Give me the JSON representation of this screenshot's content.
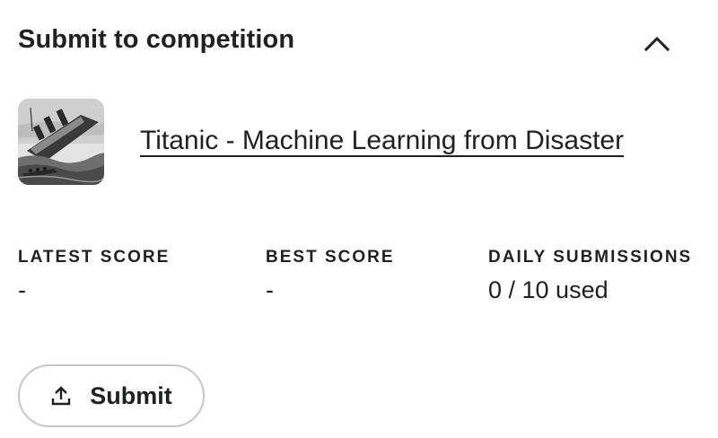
{
  "header": {
    "title": "Submit to competition",
    "collapse_icon": "chevron-up-icon"
  },
  "competition": {
    "title": "Titanic - Machine Learning from Disaster",
    "thumbnail_icon": "sinking-ship-illustration"
  },
  "stats": [
    {
      "label": "LATEST SCORE",
      "value": "-"
    },
    {
      "label": "BEST SCORE",
      "value": "-"
    },
    {
      "label": "DAILY SUBMISSIONS",
      "value": "0 / 10 used"
    }
  ],
  "actions": {
    "submit_label": "Submit",
    "submit_icon": "upload-icon"
  }
}
